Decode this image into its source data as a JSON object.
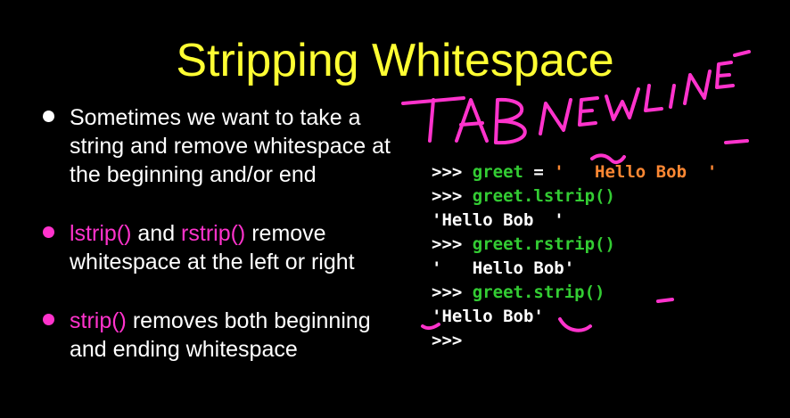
{
  "title": "Stripping Whitespace",
  "bullets": {
    "b1": "Sometimes we want to take a string and remove whitespace at the beginning and/or end",
    "b2_fn1": "lstrip()",
    "b2_mid": " and ",
    "b2_fn2": "rstrip()",
    "b2_rest": " remove whitespace at the left or right",
    "b3_fn": "strip()",
    "b3_rest": " removes both beginning and ending whitespace"
  },
  "code": {
    "prompt": ">>> ",
    "l1_var": "greet",
    "l1_eq": " = ",
    "l1_str": "'   Hello Bob  '",
    "l2_call": "greet.lstrip()",
    "l3_out": "'Hello Bob  '",
    "l4_call": "greet.rstrip()",
    "l5_out": "'   Hello Bob'",
    "l6_call": "greet.strip()",
    "l7_out": "'Hello Bob'",
    "l8_prompt": ">>>"
  },
  "annotation": "TAB NEWLINE",
  "colors": {
    "title": "#ffff33",
    "pink": "#ff33cc",
    "green": "#33cc33",
    "orange": "#ff8833",
    "ink": "#ff33cc"
  }
}
